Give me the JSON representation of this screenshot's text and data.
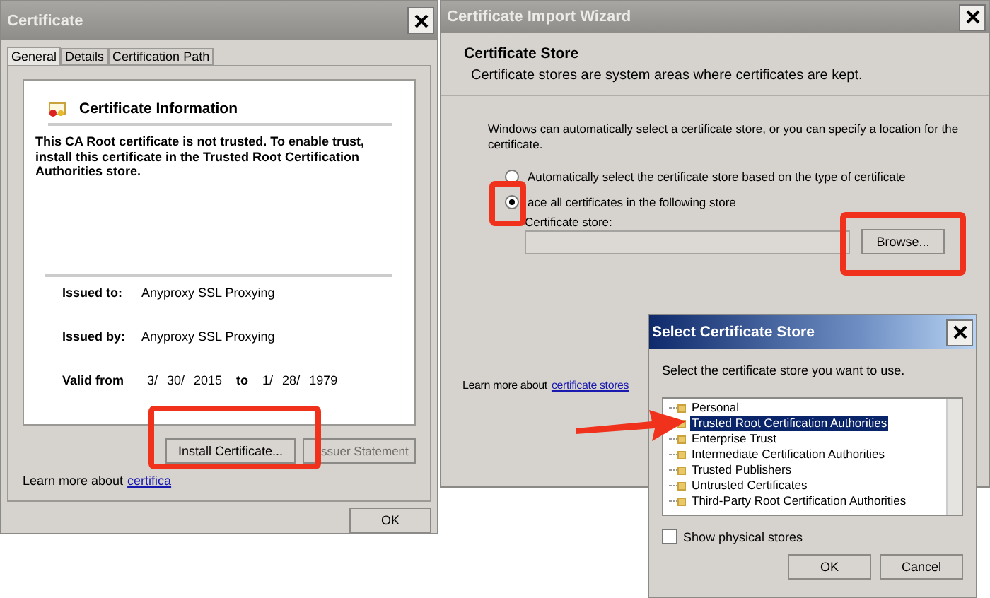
{
  "certificate_dialog": {
    "title": "Certificate",
    "tabs": [
      {
        "label": "General",
        "selected": true
      },
      {
        "label": "Details",
        "selected": false
      },
      {
        "label": "Certification Path",
        "selected": false
      }
    ],
    "info_title": "Certificate Information",
    "warning": "This CA Root certificate is not trusted. To enable trust, install this certificate in the Trusted Root Certification Authorities store.",
    "fields": [
      {
        "label": "Issued to:",
        "value": "Anyproxy SSL Proxying"
      },
      {
        "label": "Issued by:",
        "value": "Anyproxy SSL Proxying"
      }
    ],
    "valid": {
      "label": "Valid from",
      "from": "3/ 30/ 2015",
      "to_label": "to",
      "to": "1/ 28/ 1979"
    },
    "buttons": [
      {
        "label": "Install Certificate...",
        "disabled": false
      },
      {
        "label": "ssuer Statement",
        "disabled": true
      }
    ],
    "learn_more": {
      "text": "Learn more about",
      "link": "certifica"
    },
    "ok": "OK"
  },
  "import_wizard": {
    "title": "Certificate Import Wizard",
    "heading": "Certificate Store",
    "subheading": "Certificate stores are system areas where certificates are kept.",
    "intro": "Windows can automatically select a certificate store, or you can specify a location for the certificate.",
    "options": [
      {
        "label": "Automatically select the certificate store based on the type of certificate",
        "selected": false
      },
      {
        "label": "ace all certificates in the following store",
        "selected": true
      }
    ],
    "store_label": "Certificate store:",
    "browse": "Browse...",
    "learn_more": {
      "text": "Learn more about",
      "link": "certificate stores"
    }
  },
  "select_store": {
    "title": "Select Certificate Store",
    "prompt": "Select the certificate store you want to use.",
    "stores": [
      {
        "label": "Personal",
        "selected": false
      },
      {
        "label": "Trusted Root Certification Authorities",
        "selected": true
      },
      {
        "label": "Enterprise Trust",
        "selected": false
      },
      {
        "label": "Intermediate Certification Authorities",
        "selected": false
      },
      {
        "label": "Trusted Publishers",
        "selected": false
      },
      {
        "label": "Untrusted Certificates",
        "selected": false
      },
      {
        "label": "Third-Party Root Certification Authorities",
        "selected": false
      }
    ],
    "show_physical": {
      "label": "Show physical stores",
      "checked": false
    },
    "buttons": [
      "OK",
      "Cancel"
    ]
  }
}
